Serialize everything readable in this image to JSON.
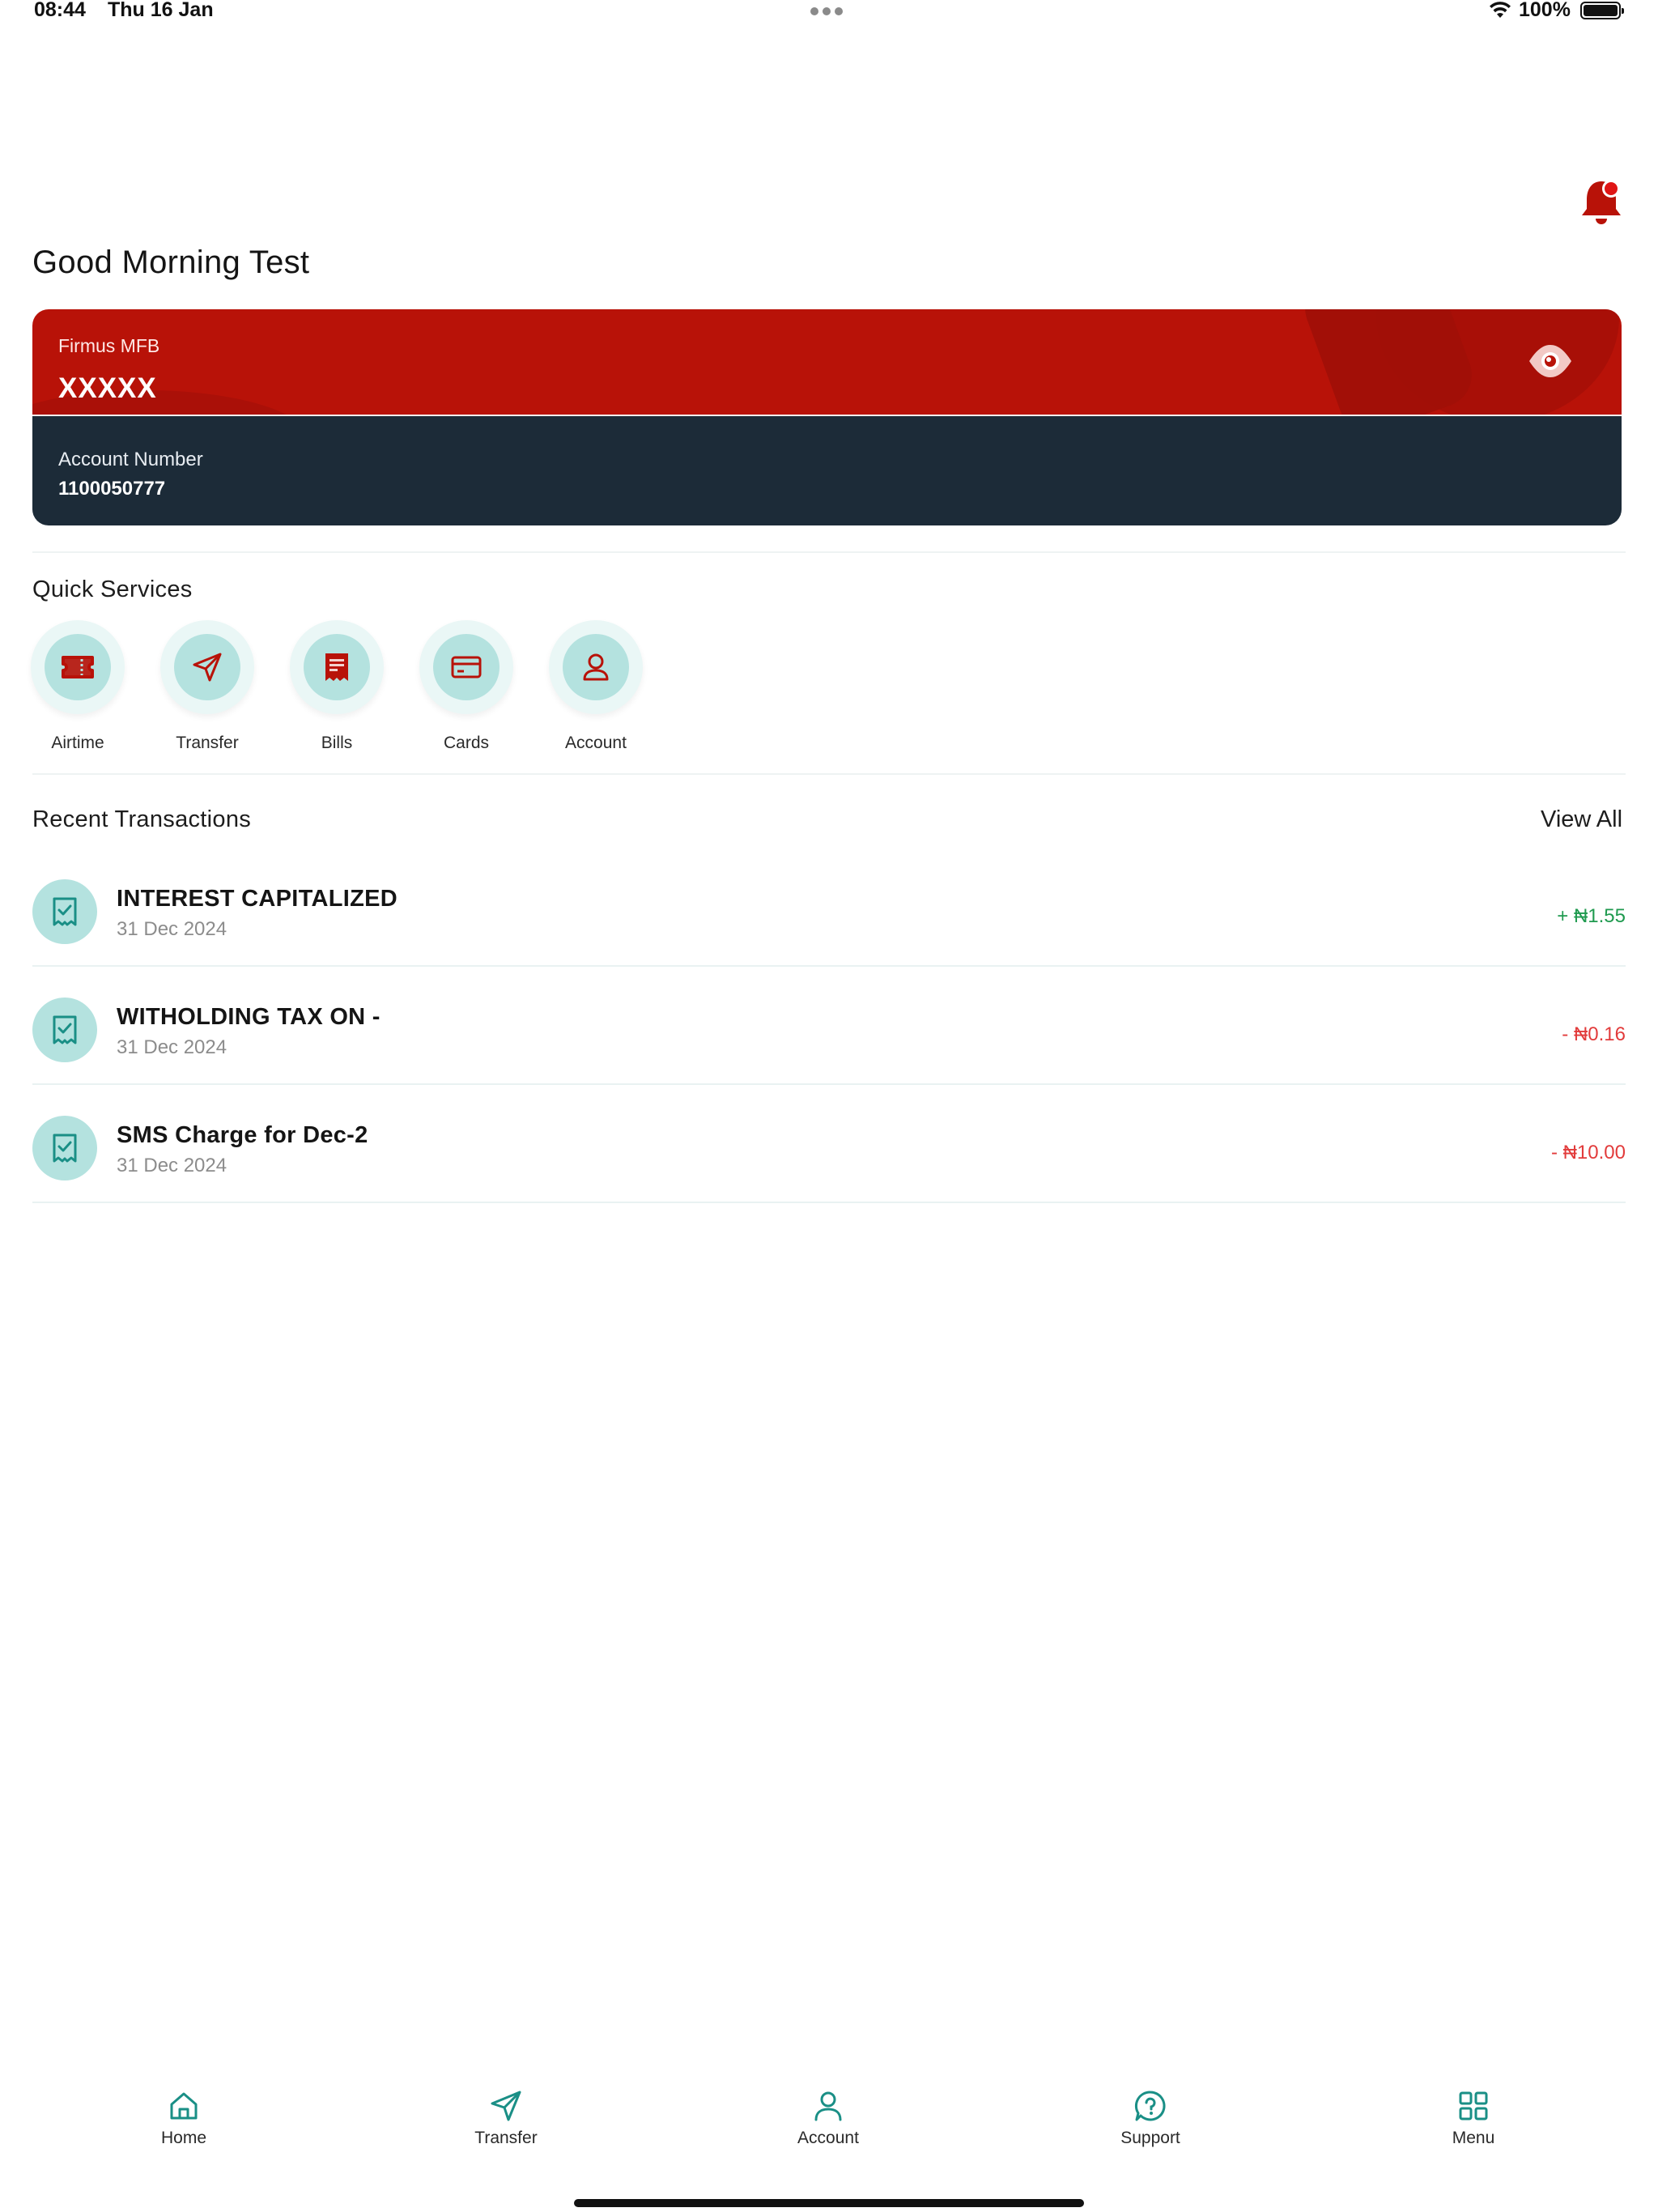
{
  "status_bar": {
    "time": "08:44",
    "date": "Thu 16 Jan",
    "battery": "100%"
  },
  "greeting": "Good Morning Test",
  "account_card": {
    "bank_name": "Firmus MFB",
    "balance": "XXXXX",
    "account_number_label": "Account Number",
    "account_number": "1100050777"
  },
  "quick_services": {
    "title": "Quick Services",
    "items": [
      {
        "label": "Airtime",
        "icon": "ticket-icon"
      },
      {
        "label": "Transfer",
        "icon": "send-icon"
      },
      {
        "label": "Bills",
        "icon": "receipt-icon"
      },
      {
        "label": "Cards",
        "icon": "credit-card-icon"
      },
      {
        "label": "Account",
        "icon": "user-icon"
      }
    ]
  },
  "recent_transactions": {
    "title": "Recent Transactions",
    "view_all": "View All",
    "items": [
      {
        "title": "INTEREST CAPITALIZED",
        "date": "31 Dec 2024",
        "amount": "+ ₦1.55",
        "type": "credit"
      },
      {
        "title": "WITHOLDING TAX ON -",
        "date": "31 Dec 2024",
        "amount": "- ₦0.16",
        "type": "debit"
      },
      {
        "title": "SMS Charge for Dec-2",
        "date": "31 Dec 2024",
        "amount": "- ₦10.00",
        "type": "debit"
      }
    ]
  },
  "bottom_nav": {
    "items": [
      {
        "label": "Home",
        "icon": "home-icon"
      },
      {
        "label": "Transfer",
        "icon": "send-icon"
      },
      {
        "label": "Account",
        "icon": "user-icon"
      },
      {
        "label": "Support",
        "icon": "help-bubble-icon"
      },
      {
        "label": "Menu",
        "icon": "grid-icon"
      }
    ]
  },
  "colors": {
    "brand_red": "#b81208",
    "card_dark": "#1c2b38",
    "teal_light": "#b4e2df",
    "teal_icon": "#1a8f86",
    "credit_green": "#1f9a4f",
    "debit_red": "#e23b3b"
  }
}
